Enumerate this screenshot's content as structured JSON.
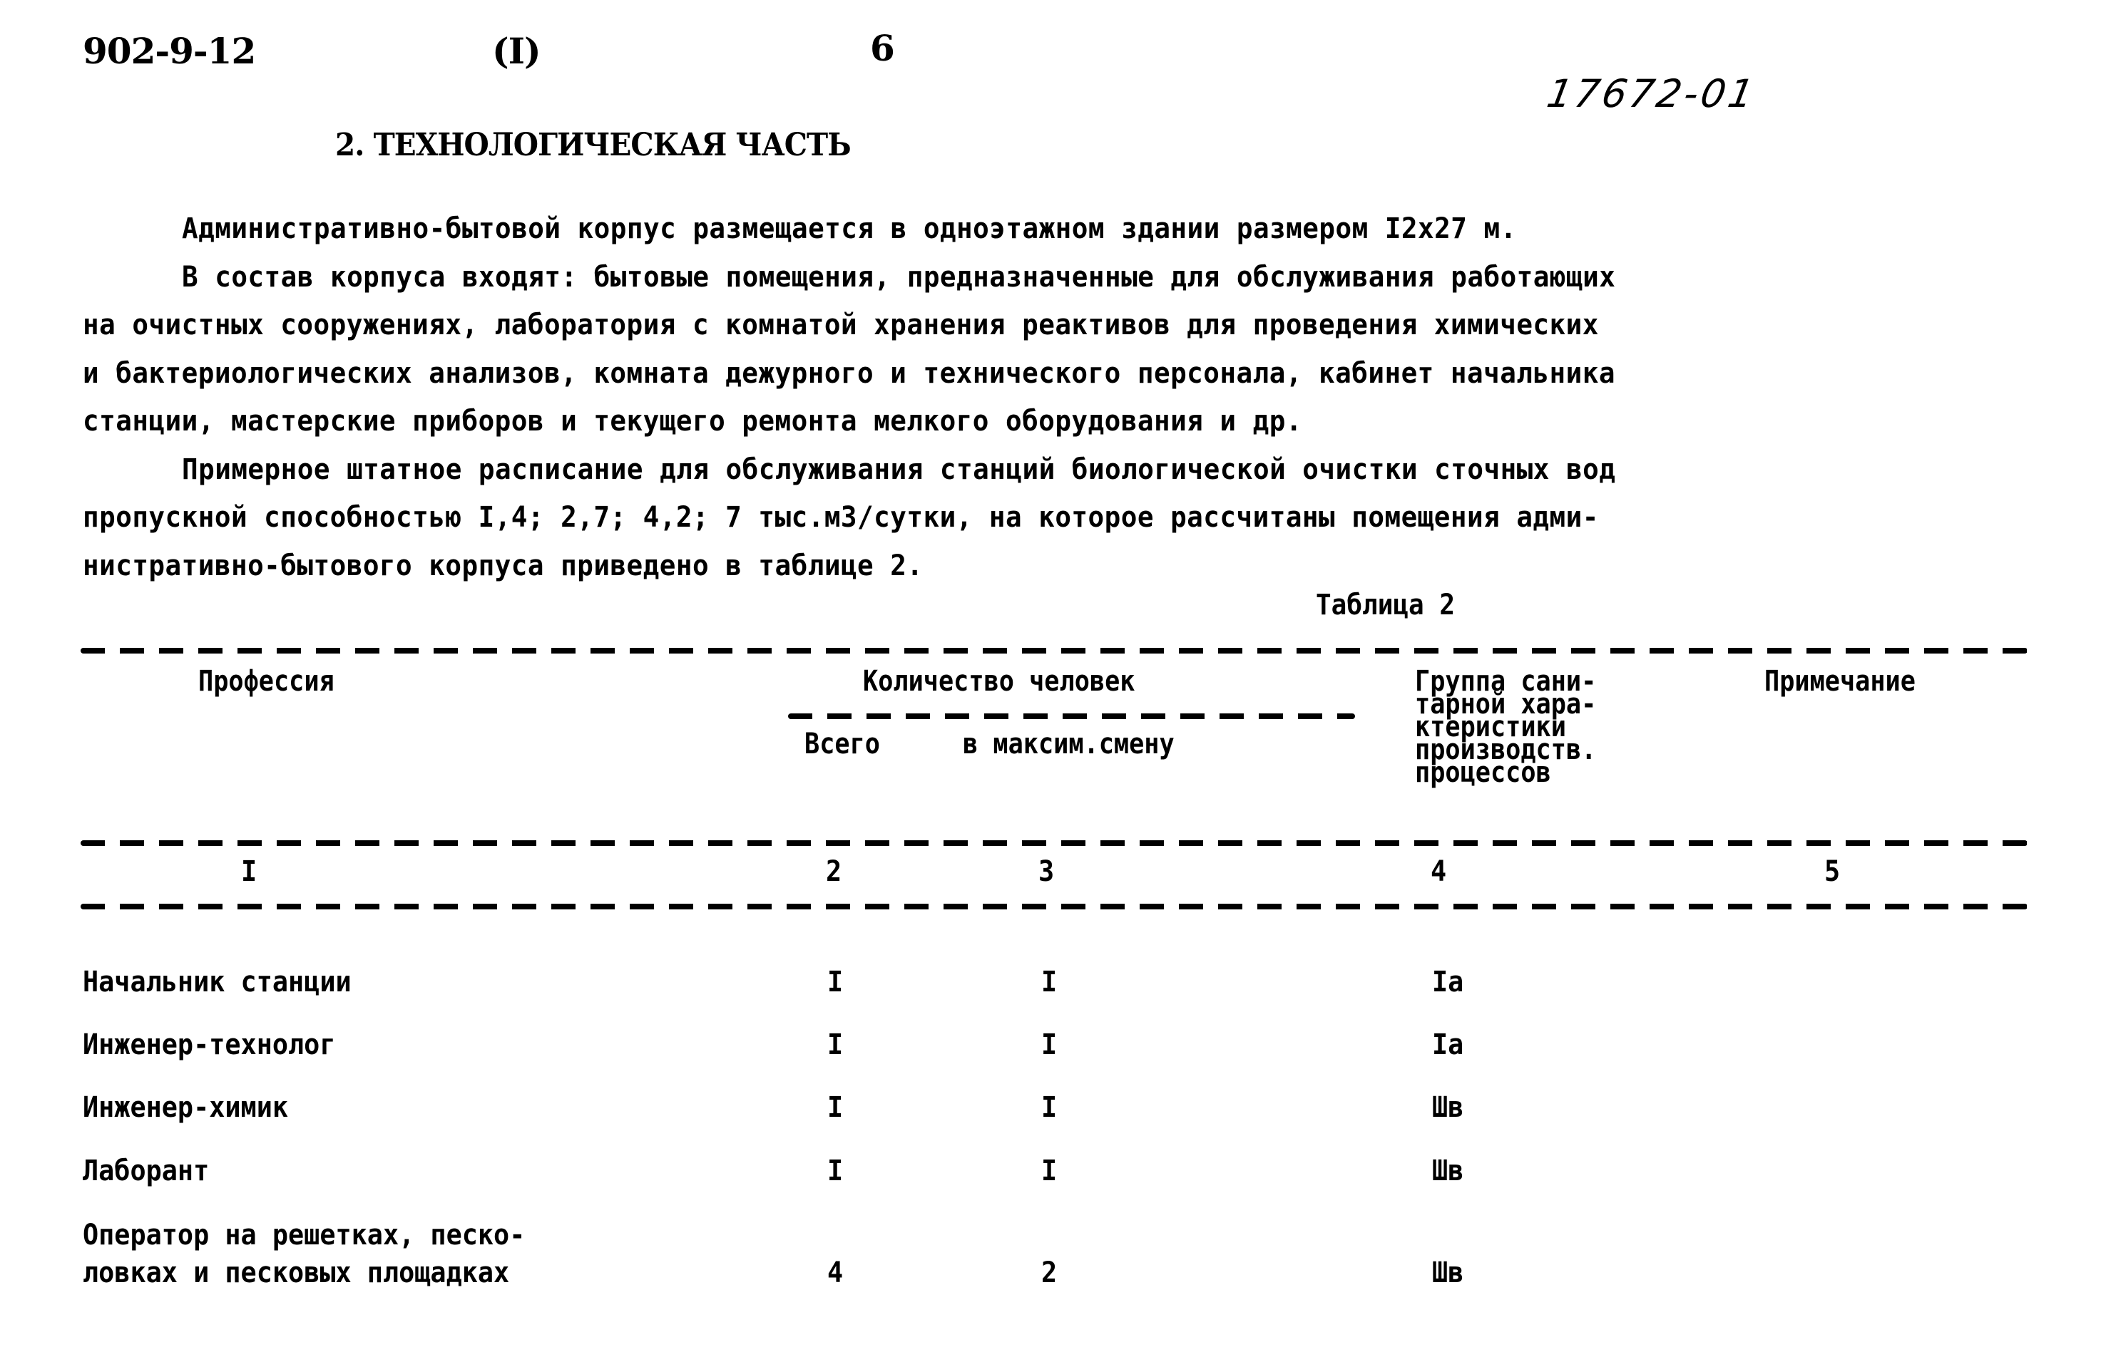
{
  "header": {
    "doc_code": "902-9-12",
    "volume": "(I)",
    "page_number": "6",
    "handwritten_number": "17672-01"
  },
  "section": {
    "title": "2. ТЕХНОЛОГИЧЕСКАЯ ЧАСТЬ",
    "paragraph_lines": [
      "Административно-бытовой корпус размещается в одноэтажном здании размером I2х27 м.",
      "В состав корпуса входят: бытовые помещения, предназначенные для обслуживания работающих",
      "на очистных сооружениях, лаборатория с комнатой хранения реактивов для проведения химических",
      "и бактериологических анализов, комната дежурного и технического персонала, кабинет начальника",
      "станции, мастерские приборов и текущего ремонта мелкого оборудования и др.",
      "Примерное штатное расписание для обслуживания станций биологической очистки сточных вод",
      "пропускной способностью I,4; 2,7; 4,2; 7 тыс.м3/сутки, на которое рассчитаны помещения адми-",
      "нистративно-бытового корпуса приведено в таблице 2."
    ]
  },
  "table": {
    "caption": "Таблица 2",
    "headers": {
      "profession": "Профессия",
      "count_group": "Количество человек",
      "total": "Всего",
      "max_shift": "в максим.смену",
      "sanitary_group_lines": [
        "Группа сани-",
        "тарной хара-",
        "ктеристики",
        "производств.",
        "процессов"
      ],
      "note": "Примечание"
    },
    "column_numbers": [
      "I",
      "2",
      "3",
      "4",
      "5"
    ],
    "rows": [
      {
        "profession": [
          "Начальник станции"
        ],
        "total": "I",
        "max_shift": "I",
        "group": "Iа",
        "note": ""
      },
      {
        "profession": [
          "Инженер-технолог"
        ],
        "total": "I",
        "max_shift": "I",
        "group": "Iа",
        "note": ""
      },
      {
        "profession": [
          "Инженер-химик"
        ],
        "total": "I",
        "max_shift": "I",
        "group": "Шв",
        "note": ""
      },
      {
        "profession": [
          "Лаборант"
        ],
        "total": "I",
        "max_shift": "I",
        "group": "Шв",
        "note": ""
      },
      {
        "profession": [
          "Оператор на решетках, песко-",
          "ловках и песковых площадках"
        ],
        "total": "4",
        "max_shift": "2",
        "group": "Шв",
        "note": ""
      }
    ]
  }
}
